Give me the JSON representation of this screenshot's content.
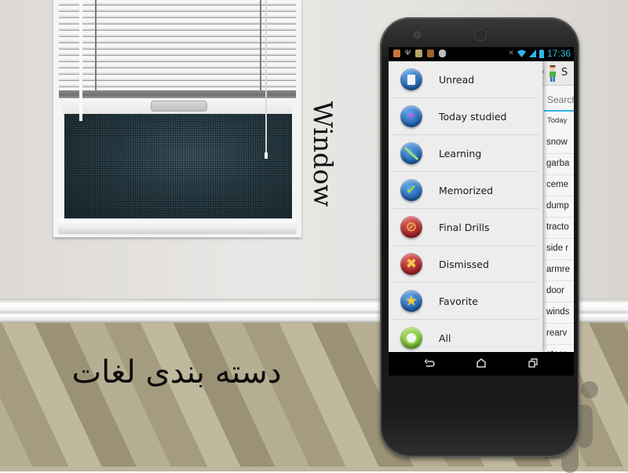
{
  "scene": {
    "window_label": "Window",
    "caption": "دسته بندی لغات"
  },
  "phone": {
    "status_bar": {
      "time": "17:36",
      "left_icons": [
        "app-notification-icon",
        "usb-icon",
        "app-notification-icon",
        "book-icon",
        "android-debug-icon"
      ],
      "right_icons": [
        "mute-icon",
        "wifi-icon",
        "signal-icon",
        "battery-icon"
      ],
      "accent_color": "#35b5e5"
    },
    "drawer": {
      "items": [
        {
          "label": "Unread",
          "icon": "document-icon",
          "color": "#1f6fc4"
        },
        {
          "label": "Today studied",
          "icon": "pin-icon",
          "color": "#1f6fc4"
        },
        {
          "label": "Learning",
          "icon": "pencil-icon",
          "color": "#1f6fc4"
        },
        {
          "label": "Memorized",
          "icon": "checkmark-icon",
          "color": "#1f6fc4"
        },
        {
          "label": "Final Drills",
          "icon": "prohibited-icon",
          "color": "#b2262a"
        },
        {
          "label": "Dismissed",
          "icon": "x-icon",
          "color": "#b2262a"
        },
        {
          "label": "Favorite",
          "icon": "star-icon",
          "color": "#1f6fc4"
        },
        {
          "label": "All",
          "icon": "all-icon",
          "color": "#7cbf2c"
        }
      ]
    },
    "main": {
      "title": "S",
      "search_placeholder": "Search",
      "section_header": "Today",
      "words": [
        "snow",
        "garba",
        "ceme",
        "dump",
        "tracto",
        "side r",
        "armre",
        "door",
        "winds",
        "rearv",
        "steer"
      ]
    },
    "navbar": {
      "back_icon": "back-icon",
      "home_icon": "home-icon",
      "recents_icon": "recents-icon"
    }
  }
}
